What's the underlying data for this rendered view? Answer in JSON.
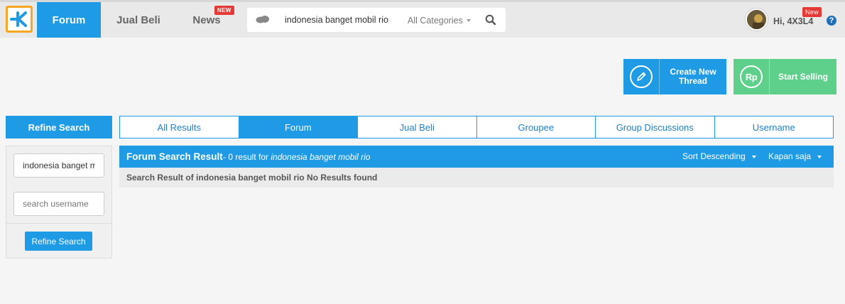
{
  "nav": {
    "logo": "K",
    "items": [
      {
        "label": "Forum",
        "active": true
      },
      {
        "label": "Jual Beli"
      },
      {
        "label": "News",
        "badge": "NEW"
      }
    ]
  },
  "search": {
    "query": "indonesia banget mobil rio",
    "category": "All Categories"
  },
  "user": {
    "greeting": "Hi, 4X3L4",
    "badge": "New",
    "help": "?"
  },
  "actions": {
    "create_thread": "Create New Thread",
    "start_selling": "Start Selling",
    "currency_icon_text": "Rp"
  },
  "refine": {
    "header": "Refine Search",
    "query_value": "indonesia banget mobil rio",
    "username_placeholder": "search username",
    "button": "Refine Search"
  },
  "tabs": [
    {
      "label": "All Results"
    },
    {
      "label": "Forum",
      "active": true
    },
    {
      "label": "Jual Beli"
    },
    {
      "label": "Groupee"
    },
    {
      "label": "Group Discussions"
    },
    {
      "label": "Username"
    }
  ],
  "results": {
    "title": "Forum Search Result",
    "count_text": " - 0 result for ",
    "query": "indonesia banget mobil rio",
    "sort": "Sort Descending",
    "time": "Kapan saja",
    "message": "Search Result of indonesia banget mobil rio No Results found"
  },
  "colors": {
    "primary": "#1e9be4",
    "sell": "#5fd08c",
    "badge": "#e53935",
    "logo_border": "#f5a623"
  }
}
